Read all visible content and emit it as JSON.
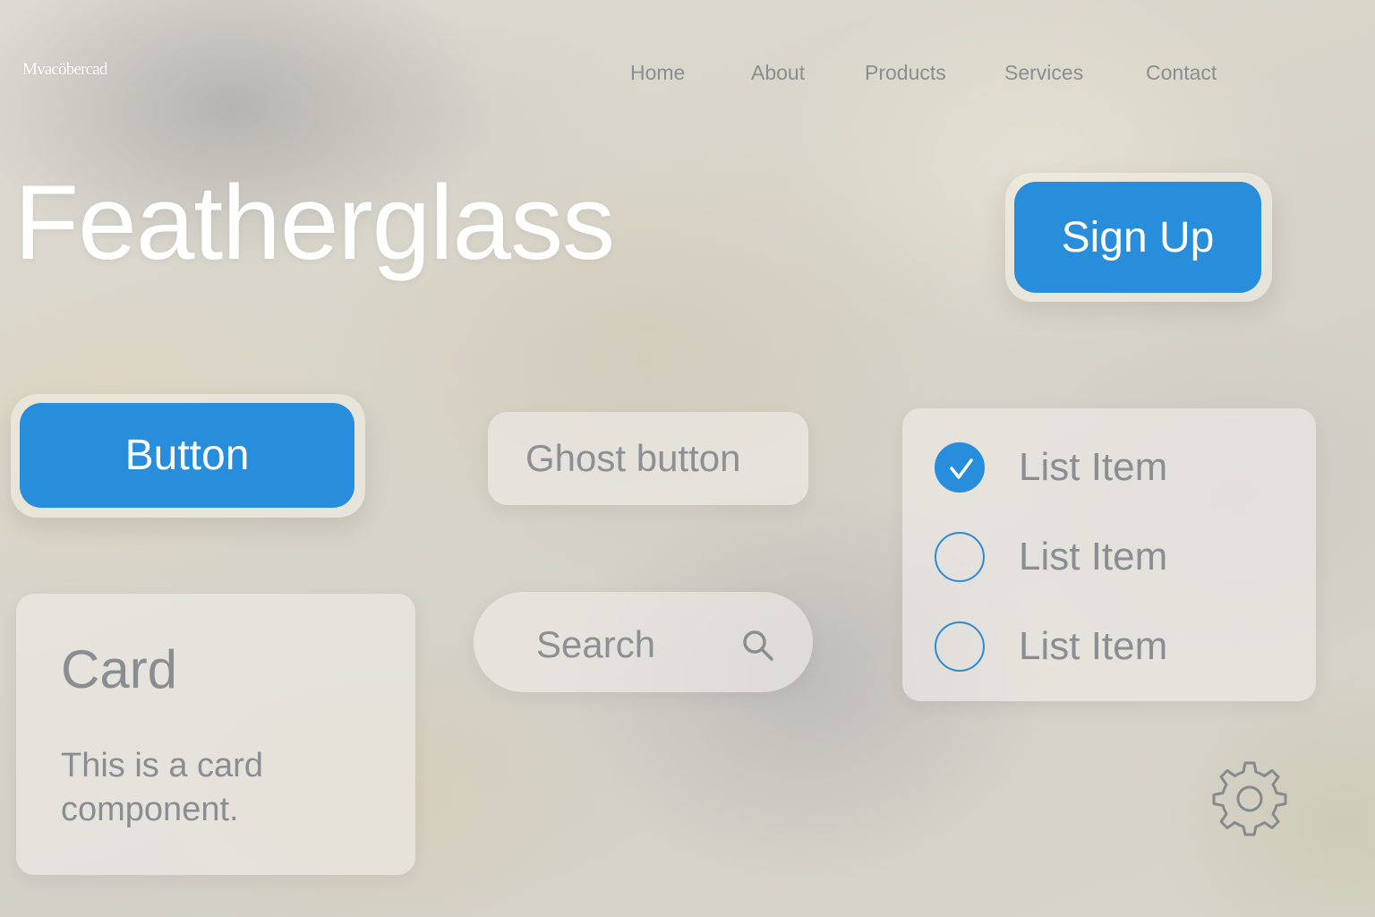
{
  "header": {
    "logo_text": "Mvacöbercad",
    "nav": [
      {
        "label": "Home"
      },
      {
        "label": "About"
      },
      {
        "label": "Products"
      },
      {
        "label": "Services"
      },
      {
        "label": "Contact"
      }
    ]
  },
  "hero": {
    "title": "Featherglass",
    "signup_label": "Sign Up"
  },
  "controls": {
    "button_label": "Button",
    "ghost_label": "Ghost button",
    "search_placeholder": "Search",
    "search_icon": "search-icon"
  },
  "card": {
    "title": "Card",
    "body": "This is a card component."
  },
  "list": {
    "items": [
      {
        "label": "List Item",
        "checked": true
      },
      {
        "label": "List Item",
        "checked": false
      },
      {
        "label": "List Item",
        "checked": false
      }
    ]
  },
  "icons": {
    "settings": "gear-icon",
    "check": "check-icon"
  },
  "colors": {
    "accent": "#288dda",
    "text_muted": "#8a8d91",
    "hero_text": "#ffffff"
  }
}
